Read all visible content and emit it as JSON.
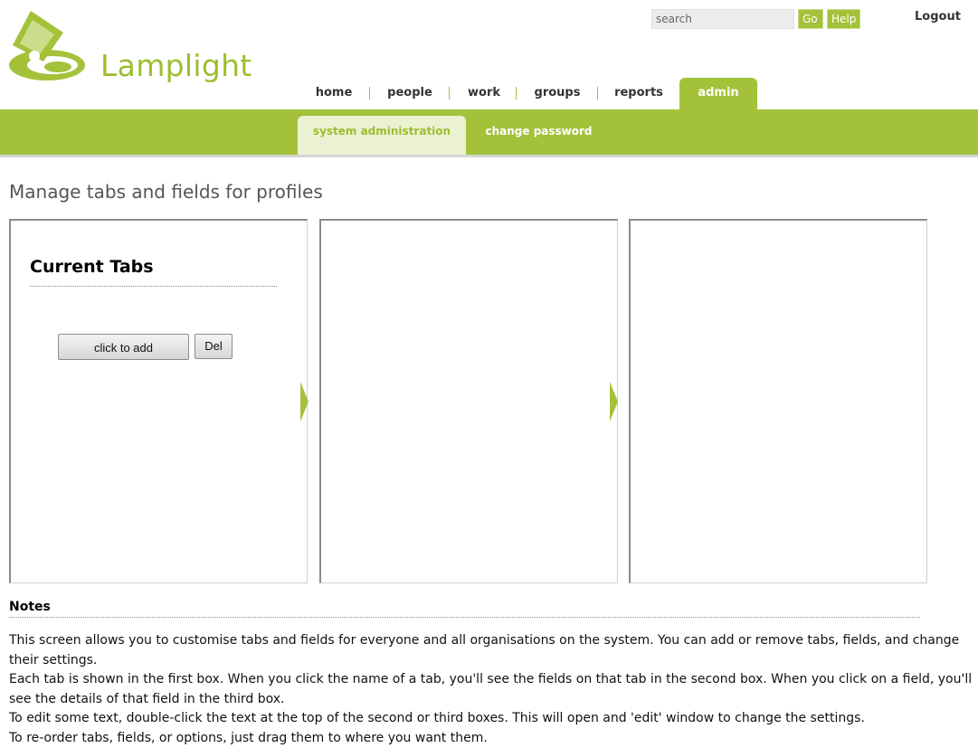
{
  "brand": {
    "name": "Lamplight"
  },
  "header": {
    "search_placeholder": "search",
    "go_label": "Go",
    "help_label": "Help",
    "logout_label": "Logout"
  },
  "nav": {
    "items": [
      {
        "label": "home"
      },
      {
        "label": "people"
      },
      {
        "label": "work"
      },
      {
        "label": "groups"
      },
      {
        "label": "reports"
      },
      {
        "label": "admin",
        "active": true
      }
    ]
  },
  "subnav": {
    "items": [
      {
        "label": "system administration",
        "active": true
      },
      {
        "label": "change password"
      }
    ]
  },
  "page": {
    "title": "Manage tabs and fields for profiles",
    "panel1": {
      "heading": "Current Tabs",
      "add_label": "click to add",
      "del_label": "Del"
    }
  },
  "notes": {
    "heading": "Notes",
    "paragraphs": [
      "This screen allows you to customise tabs and fields for everyone and all organisations on the system. You can add or remove tabs, fields, and change their settings.",
      "Each tab is shown in the first box. When you click the name of a tab, you'll see the fields on that tab in the second box. When you click on a field, you'll see the details of that field in the third box.",
      "To edit some text, double-click the text at the top of the second or third boxes. This will open and 'edit' window to change the settings.",
      "To re-order tabs, fields, or options, just drag them to where you want them."
    ]
  },
  "colors": {
    "accent": "#a3c23a",
    "accent_light": "#eaf2d2",
    "title_gray": "#555555"
  },
  "icons": {
    "logo": "lamp-logo-icon",
    "panel_arrow": "arrow-right-icon"
  }
}
